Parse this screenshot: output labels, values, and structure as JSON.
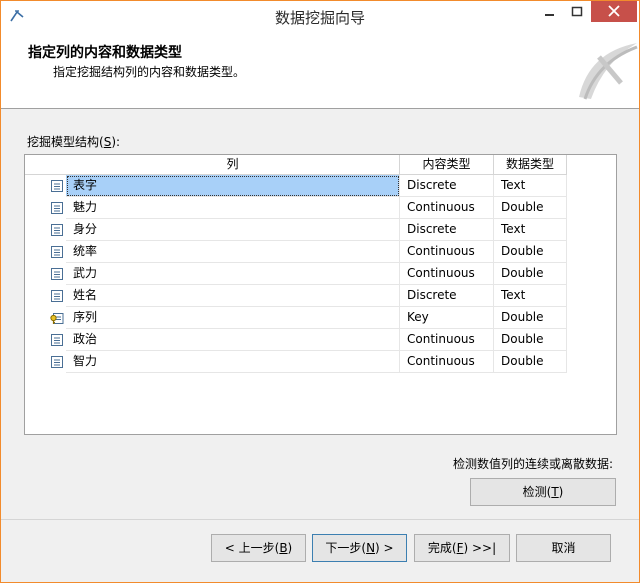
{
  "window": {
    "title": "数据挖掘向导",
    "accent_color": "#f28b2c",
    "close_color": "#c7504a"
  },
  "header": {
    "title": "指定列的内容和数据类型",
    "subtitle": "指定挖掘结构列的内容和数据类型。"
  },
  "grid": {
    "label_prefix": "挖掘模型结构(",
    "label_key": "S",
    "label_suffix": "):",
    "columns": [
      "列",
      "内容类型",
      "数据类型"
    ],
    "rows": [
      {
        "name": "表字",
        "content_type": "Discrete",
        "data_type": "Text",
        "icon": "column-icon",
        "selected": true
      },
      {
        "name": "魅力",
        "content_type": "Continuous",
        "data_type": "Double",
        "icon": "column-icon"
      },
      {
        "name": "身分",
        "content_type": "Discrete",
        "data_type": "Text",
        "icon": "column-icon"
      },
      {
        "name": "统率",
        "content_type": "Continuous",
        "data_type": "Double",
        "icon": "column-icon"
      },
      {
        "name": "武力",
        "content_type": "Continuous",
        "data_type": "Double",
        "icon": "column-icon"
      },
      {
        "name": "姓名",
        "content_type": "Discrete",
        "data_type": "Text",
        "icon": "column-icon"
      },
      {
        "name": "序列",
        "content_type": "Key",
        "data_type": "Double",
        "icon": "key-column-icon"
      },
      {
        "name": "政治",
        "content_type": "Continuous",
        "data_type": "Double",
        "icon": "column-icon"
      },
      {
        "name": "智力",
        "content_type": "Continuous",
        "data_type": "Double",
        "icon": "column-icon"
      }
    ]
  },
  "detect": {
    "label": "检测数值列的连续或离散数据:",
    "button_prefix": "检测(",
    "button_key": "T",
    "button_suffix": ")"
  },
  "footer": {
    "prev": {
      "prefix": "< 上一步(",
      "key": "B",
      "suffix": ")"
    },
    "next": {
      "prefix": "下一步(",
      "key": "N",
      "suffix": ") >"
    },
    "finish": {
      "prefix": "完成(",
      "key": "F",
      "suffix": ") >>|"
    },
    "cancel": "取消"
  }
}
